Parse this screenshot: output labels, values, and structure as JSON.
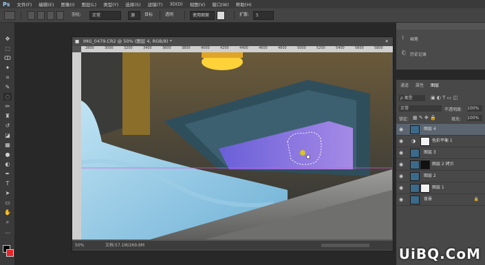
{
  "app": {
    "logo": "Ps"
  },
  "menu": [
    "文件(F)",
    "编辑(E)",
    "图像(I)",
    "图层(L)",
    "类型(Y)",
    "选择(S)",
    "滤镜(T)",
    "3D(D)",
    "视图(V)",
    "窗口(W)",
    "帮助(H)"
  ],
  "options_bar": {
    "feather_label": "羽化:",
    "mode_value": "正常",
    "source_label": "源",
    "destination_label": "目标",
    "transparent_label": "透明",
    "use_pattern_label": "使用图案",
    "diffusion_label": "扩散:",
    "diffusion_value": "5"
  },
  "document": {
    "title": "IMG_0479.CR2 @ 50% (图层 4, RGB/8) *",
    "ruler_ticks": [
      "2800",
      "3000",
      "3200",
      "3400",
      "3600",
      "3800",
      "4000",
      "4200",
      "4400",
      "4600",
      "4800",
      "5000",
      "5200",
      "5400",
      "5600",
      "5800"
    ],
    "zoom": "50%",
    "doc_info": "文档:57.1M/269.6M"
  },
  "panels": {
    "history_items": [
      "画笔",
      "历史记录"
    ],
    "layers_tabs": [
      "通道",
      "属性",
      "图层"
    ],
    "filter_value": "ρ 类型",
    "blend_mode": "正常",
    "opacity_label": "不透明度:",
    "opacity_value": "100%",
    "lock_label": "锁定:",
    "fill_label": "填充:",
    "fill_value": "100%",
    "layers": [
      {
        "name": "图层 4"
      },
      {
        "name": "色彩平衡 1"
      },
      {
        "name": "图层 3"
      },
      {
        "name": "图层 2 拷贝"
      },
      {
        "name": "图层 2"
      },
      {
        "name": "图层 1"
      },
      {
        "name": "背景"
      }
    ]
  },
  "watermark": "UiBQ.CoM",
  "colors": {
    "accent_guide": "#d45bd1",
    "selected_layer": "#5b6570"
  }
}
